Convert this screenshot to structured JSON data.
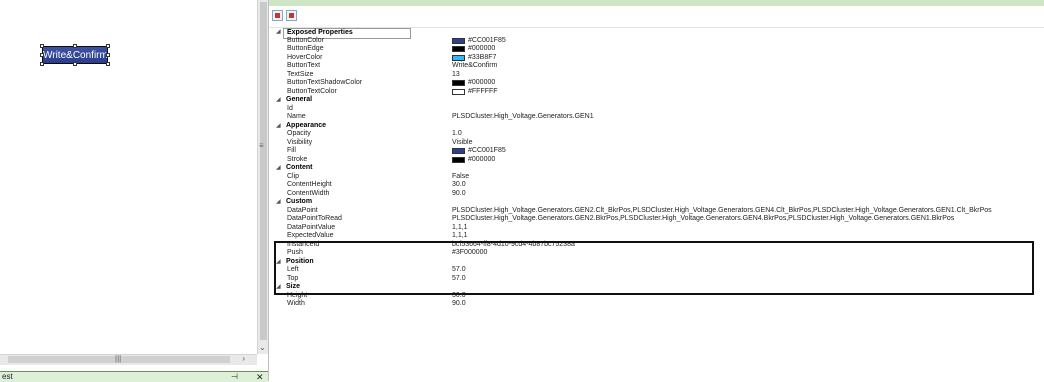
{
  "design_canvas": {
    "button_text": "Write&Confirm"
  },
  "bottom_tab": {
    "label": "est",
    "pin_icon": "pin-icon",
    "close_icon": "close-icon"
  },
  "colors": {
    "button": "#CC001F85",
    "edge": "#000000",
    "hover": "#33B8F7",
    "shadow": "#000000",
    "text": "#FFFFFF",
    "fill": "#CC001F85",
    "stroke": "#000000"
  },
  "properties": [
    {
      "kind": "cat",
      "name": "Exposed Properties"
    },
    {
      "kind": "prop",
      "name": "ButtonColor",
      "value": "#CC001F85",
      "swatch": "#2e3f8f"
    },
    {
      "kind": "prop",
      "name": "ButtonEdge",
      "value": "#000000",
      "swatch": "#000000"
    },
    {
      "kind": "prop",
      "name": "HoverColor",
      "value": "#33B8F7",
      "swatch": "#33B8F7"
    },
    {
      "kind": "prop",
      "name": "ButtonText",
      "value": "Write&Confirm"
    },
    {
      "kind": "prop",
      "name": "TextSize",
      "value": "13"
    },
    {
      "kind": "prop",
      "name": "ButtonTextShadowColor",
      "value": "#000000",
      "swatch": "#000000"
    },
    {
      "kind": "prop",
      "name": "ButtonTextColor",
      "value": "#FFFFFF",
      "swatch": "#FFFFFF"
    },
    {
      "kind": "cat",
      "name": "General"
    },
    {
      "kind": "prop",
      "name": "Id",
      "value": ""
    },
    {
      "kind": "prop",
      "name": "Name",
      "value": "PLSDCluster.High_Voltage.Generators.GEN1"
    },
    {
      "kind": "cat",
      "name": "Appearance"
    },
    {
      "kind": "prop",
      "name": "Opacity",
      "value": "1.0"
    },
    {
      "kind": "prop",
      "name": "Visibility",
      "value": "Visible"
    },
    {
      "kind": "prop",
      "name": "Fill",
      "value": "#CC001F85",
      "swatch": "#2e3f8f"
    },
    {
      "kind": "prop",
      "name": "Stroke",
      "value": "#000000",
      "swatch": "#000000"
    },
    {
      "kind": "cat",
      "name": "Content"
    },
    {
      "kind": "prop",
      "name": "Clip",
      "value": "False"
    },
    {
      "kind": "prop",
      "name": "ContentHeight",
      "value": "30.0"
    },
    {
      "kind": "prop",
      "name": "ContentWidth",
      "value": "90.0"
    },
    {
      "kind": "cat",
      "name": "Custom"
    },
    {
      "kind": "prop",
      "name": "DataPoint",
      "value": "PLSDCluster.High_Voltage.Generators.GEN2.Clt_BkrPos,PLSDCluster.High_Voltage.Generators.GEN4.Clt_BkrPos,PLSDCluster.High_Voltage.Generators.GEN1.Clt_BkrPos"
    },
    {
      "kind": "prop",
      "name": "DataPointToRead",
      "value": "PLSDCluster.High_Voltage.Generators.GEN2.BkrPos,PLSDCluster.High_Voltage.Generators.GEN4.BkrPos,PLSDCluster.High_Voltage.Generators.GEN1.BkrPos"
    },
    {
      "kind": "prop",
      "name": "DataPointValue",
      "value": "1,1,1"
    },
    {
      "kind": "prop",
      "name": "ExpectedValue",
      "value": "1,1,1"
    },
    {
      "kind": "prop",
      "name": "InstanceId",
      "value": "bcf53664-ff8-4d10-9cd4-4b87bc75238a"
    },
    {
      "kind": "prop",
      "name": "Push",
      "value": "#3F000000"
    },
    {
      "kind": "cat",
      "name": "Position"
    },
    {
      "kind": "prop",
      "name": "Left",
      "value": "57.0"
    },
    {
      "kind": "prop",
      "name": "Top",
      "value": "57.0"
    },
    {
      "kind": "cat",
      "name": "Size"
    },
    {
      "kind": "prop",
      "name": "Height",
      "value": "30.0"
    },
    {
      "kind": "prop",
      "name": "Width",
      "value": "90.0"
    }
  ]
}
